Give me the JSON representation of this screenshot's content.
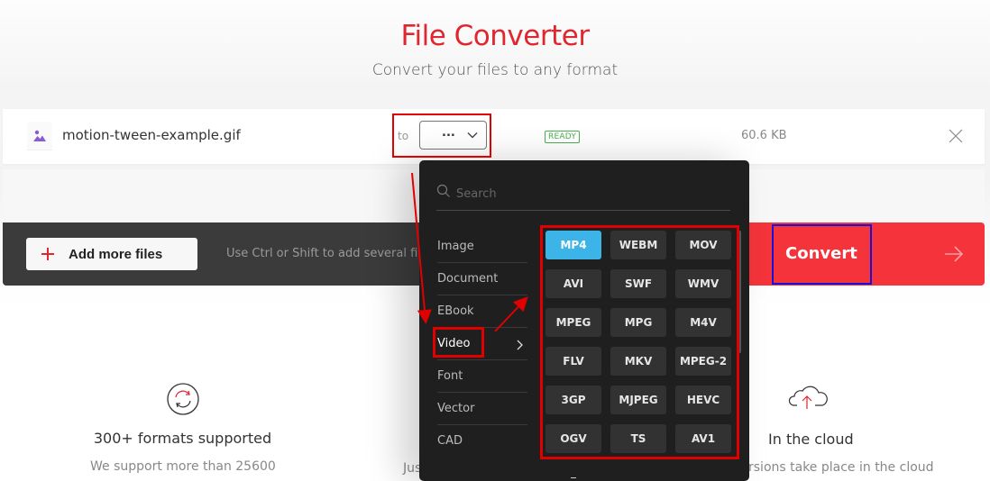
{
  "header": {
    "title": "File Converter",
    "subtitle": "Convert your files to any format"
  },
  "file_row": {
    "file_icon": "image-icon",
    "file_name": "motion-tween-example.gif",
    "to_label": "to",
    "format_select_value": "...",
    "status_badge": "READY",
    "file_size": "60.6 KB",
    "remove_icon": "close-icon"
  },
  "action_bar": {
    "add_files_label": "Add more files",
    "hint": "Use Ctrl or Shift to add several files a",
    "convert_label": "Convert"
  },
  "dropdown": {
    "search_placeholder": "Search",
    "categories": [
      {
        "label": "Image",
        "active": false
      },
      {
        "label": "Document",
        "active": false
      },
      {
        "label": "EBook",
        "active": false
      },
      {
        "label": "Video",
        "active": true
      },
      {
        "label": "Font",
        "active": false
      },
      {
        "label": "Vector",
        "active": false
      },
      {
        "label": "CAD",
        "active": false
      }
    ],
    "formats": [
      "MP4",
      "WEBM",
      "MOV",
      "AVI",
      "SWF",
      "WMV",
      "MPEG",
      "MPG",
      "M4V",
      "FLV",
      "MKV",
      "MPEG-2",
      "3GP",
      "MJPEG",
      "HEVC",
      "OGV",
      "TS",
      "AV1"
    ],
    "selected_format": "MP4"
  },
  "features": [
    {
      "icon": "refresh-icon",
      "title": "300+ formats supported",
      "desc": "We support more than 25600"
    },
    {
      "icon": "",
      "title": "",
      "desc": "Jus"
    },
    {
      "icon": "cloud-upload-icon",
      "title": "In the cloud",
      "desc": "rsions take place in the cloud"
    }
  ],
  "colors": {
    "brand_red": "#e0262f",
    "convert_red": "#f4333a",
    "selected_format": "#3cb4e8",
    "ready_green": "#4caf50",
    "annotation_red": "#e00000",
    "annotation_blue": "#1a10d8"
  }
}
